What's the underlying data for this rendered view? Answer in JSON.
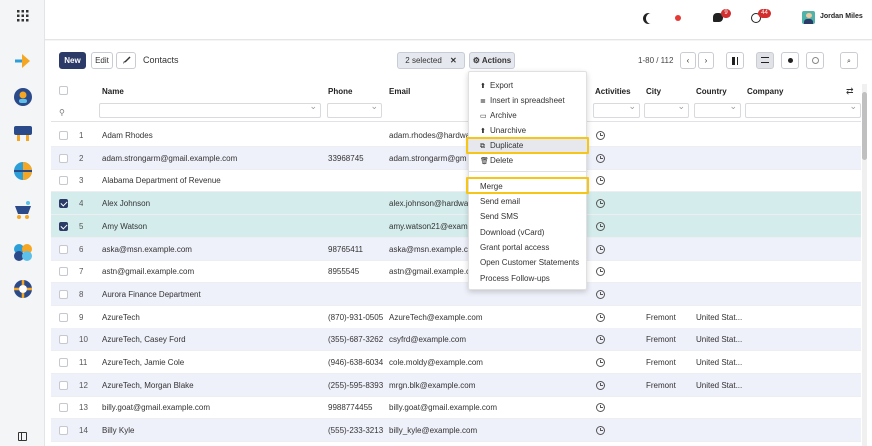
{
  "topbar": {
    "notif_messages": "9",
    "notif_activities": "44",
    "user_name": "Jordan Miles"
  },
  "toolbar": {
    "new_label": "New",
    "edit_label": "Edit",
    "breadcrumb": "Contacts",
    "selected_label": "2 selected",
    "actions_label": "Actions",
    "pager": "1-80 / 112"
  },
  "columns": {
    "name": "Name",
    "phone": "Phone",
    "email": "Email",
    "activities": "Activities",
    "city": "City",
    "country": "Country",
    "company": "Company"
  },
  "menu": {
    "export": "Export",
    "insert": "Insert in spreadsheet",
    "archive": "Archive",
    "unarchive": "Unarchive",
    "duplicate": "Duplicate",
    "delete": "Delete",
    "merge": "Merge",
    "send_email": "Send email",
    "send_sms": "Send SMS",
    "download": "Download (vCard)",
    "grant": "Grant portal access",
    "statements": "Open Customer Statements",
    "followups": "Process Follow-ups"
  },
  "rows": [
    {
      "n": "1",
      "name": "Adam Rhodes",
      "phone": "",
      "email": "adam.rhodes@hardwa",
      "city": "",
      "country": ""
    },
    {
      "n": "2",
      "name": "adam.strongarm@gmail.example.com",
      "phone": "33968745",
      "email": "adam.strongarm@gm",
      "city": "",
      "country": ""
    },
    {
      "n": "3",
      "name": "Alabama Department of Revenue",
      "phone": "",
      "email": "",
      "city": "",
      "country": ""
    },
    {
      "n": "4",
      "name": "Alex Johnson",
      "phone": "",
      "email": "alex.johnson@hardwa",
      "city": "",
      "country": ""
    },
    {
      "n": "5",
      "name": "Amy Watson",
      "phone": "",
      "email": "amy.watson21@examp",
      "city": "",
      "country": ""
    },
    {
      "n": "6",
      "name": "aska@msn.example.com",
      "phone": "98765411",
      "email": "aska@msn.example.co",
      "city": "",
      "country": ""
    },
    {
      "n": "7",
      "name": "astn@gmail.example.com",
      "phone": "8955545",
      "email": "astn@gmail.example.c",
      "city": "",
      "country": ""
    },
    {
      "n": "8",
      "name": "Aurora Finance Department",
      "phone": "",
      "email": "",
      "city": "",
      "country": ""
    },
    {
      "n": "9",
      "name": "AzureTech",
      "phone": "(870)-931-0505",
      "email": "AzureTech@example.com",
      "city": "Fremont",
      "country": "United Stat..."
    },
    {
      "n": "10",
      "name": "AzureTech, Casey Ford",
      "phone": "(355)-687-3262",
      "email": "csyfrd@example.com",
      "city": "Fremont",
      "country": "United Stat..."
    },
    {
      "n": "11",
      "name": "AzureTech, Jamie Cole",
      "phone": "(946)-638-6034",
      "email": "cole.moldy@example.com",
      "city": "Fremont",
      "country": "United Stat..."
    },
    {
      "n": "12",
      "name": "AzureTech, Morgan Blake",
      "phone": "(255)-595-8393",
      "email": "mrgn.blk@example.com",
      "city": "Fremont",
      "country": "United Stat..."
    },
    {
      "n": "13",
      "name": "billy.goat@gmail.example.com",
      "phone": "9988774455",
      "email": "billy.goat@gmail.example.com",
      "city": "",
      "country": ""
    },
    {
      "n": "14",
      "name": "Billy Kyle",
      "phone": "(555)-233-3213",
      "email": "billy_kyle@example.com",
      "city": "",
      "country": ""
    }
  ]
}
